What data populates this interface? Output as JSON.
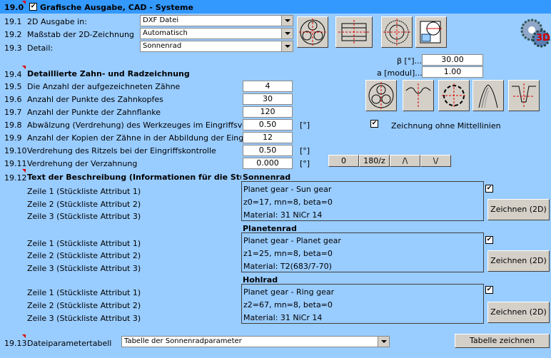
{
  "header": {
    "num": "19.0",
    "title": "Grafische Ausgabe, CAD - Systeme",
    "checked": "✔"
  },
  "rows": {
    "r1": {
      "num": "19.1",
      "label": "2D Ausgabe in:",
      "value": "DXF Datei"
    },
    "r2": {
      "num": "19.2",
      "label": "Maßstab der 2D-Zeichnung",
      "value": "Automatisch"
    },
    "r3": {
      "num": "19.3",
      "label": "Detail:",
      "value": "Sonnenrad"
    }
  },
  "params": {
    "beta_label": "β [°]...",
    "beta": "30.00",
    "a_label": "a [modul]...",
    "a": "1.00"
  },
  "section4": {
    "num": "19.4",
    "title": "Detaillierte Zahn- und Radzeichnung"
  },
  "details": [
    {
      "num": "19.5",
      "label": "Die Anzahl der aufgezeichneten Zähne",
      "value": "4"
    },
    {
      "num": "19.6",
      "label": "Anzahl der Punkte des Zahnkopfes",
      "value": "30"
    },
    {
      "num": "19.7",
      "label": "Anzahl der Punkte der Zahnflanke",
      "value": "120"
    },
    {
      "num": "19.8",
      "label": "Abwälzung (Verdrehung) des Werkzeuges im Eingriffsverlauf",
      "value": "0.50",
      "unit": "[°]"
    },
    {
      "num": "19.9",
      "label": "Anzahl der Kopien der Zähne in der Abbildung der Eingriffskont",
      "value": "12"
    },
    {
      "num": "19.10",
      "label": "Verdrehung des Ritzels bei der Eingriffskontrolle",
      "value": "0.50",
      "unit": "[°]"
    },
    {
      "num": "19.11",
      "label": "Verdrehung der Verzahnung",
      "value": "0.000",
      "unit": "[°]"
    }
  ],
  "no_centerlines": {
    "label": "Zeichnung ohne Mittellinien",
    "checked": "✔"
  },
  "rot_buttons": [
    "0",
    "180/z",
    "/\\",
    "\\/"
  ],
  "section12": {
    "num": "19.12",
    "title": "Text der Beschreibung (Informationen für die Stückli"
  },
  "attr_labels": [
    "Zeile 1 (Stückliste Attribut 1)",
    "Zeile 2 (Stückliste Attribut 2)",
    "Zeile 3 (Stückliste Attribut 3)"
  ],
  "gears": [
    {
      "title": "Sonnenrad",
      "lines": [
        "Planet gear - Sun gear",
        "z0=17, mn=8, beta=0",
        "Material: 31 NiCr 14"
      ],
      "button": "Zeichnen (2D)",
      "checked": "✔"
    },
    {
      "title": "Planetenrad",
      "lines": [
        "Planet gear - Planet gear",
        "z1=25, mn=8, beta=0",
        "Material: T2(683/7-70)"
      ],
      "button": "Zeichnen (2D)",
      "checked": "✔"
    },
    {
      "title": "Hohlrad",
      "lines": [
        "Planet gear - Ring gear",
        "z2=67, mn=8, beta=0",
        "Material: 31 NiCr 14"
      ],
      "button": "Zeichnen (2D)",
      "checked": "✔"
    }
  ],
  "footer": {
    "num": "19.13",
    "label": "Dateiparametertabell",
    "select": "Tabelle der Sonnenradparameter",
    "button": "Tabelle zeichnen"
  },
  "icons": {
    "btn3d": "3D"
  }
}
